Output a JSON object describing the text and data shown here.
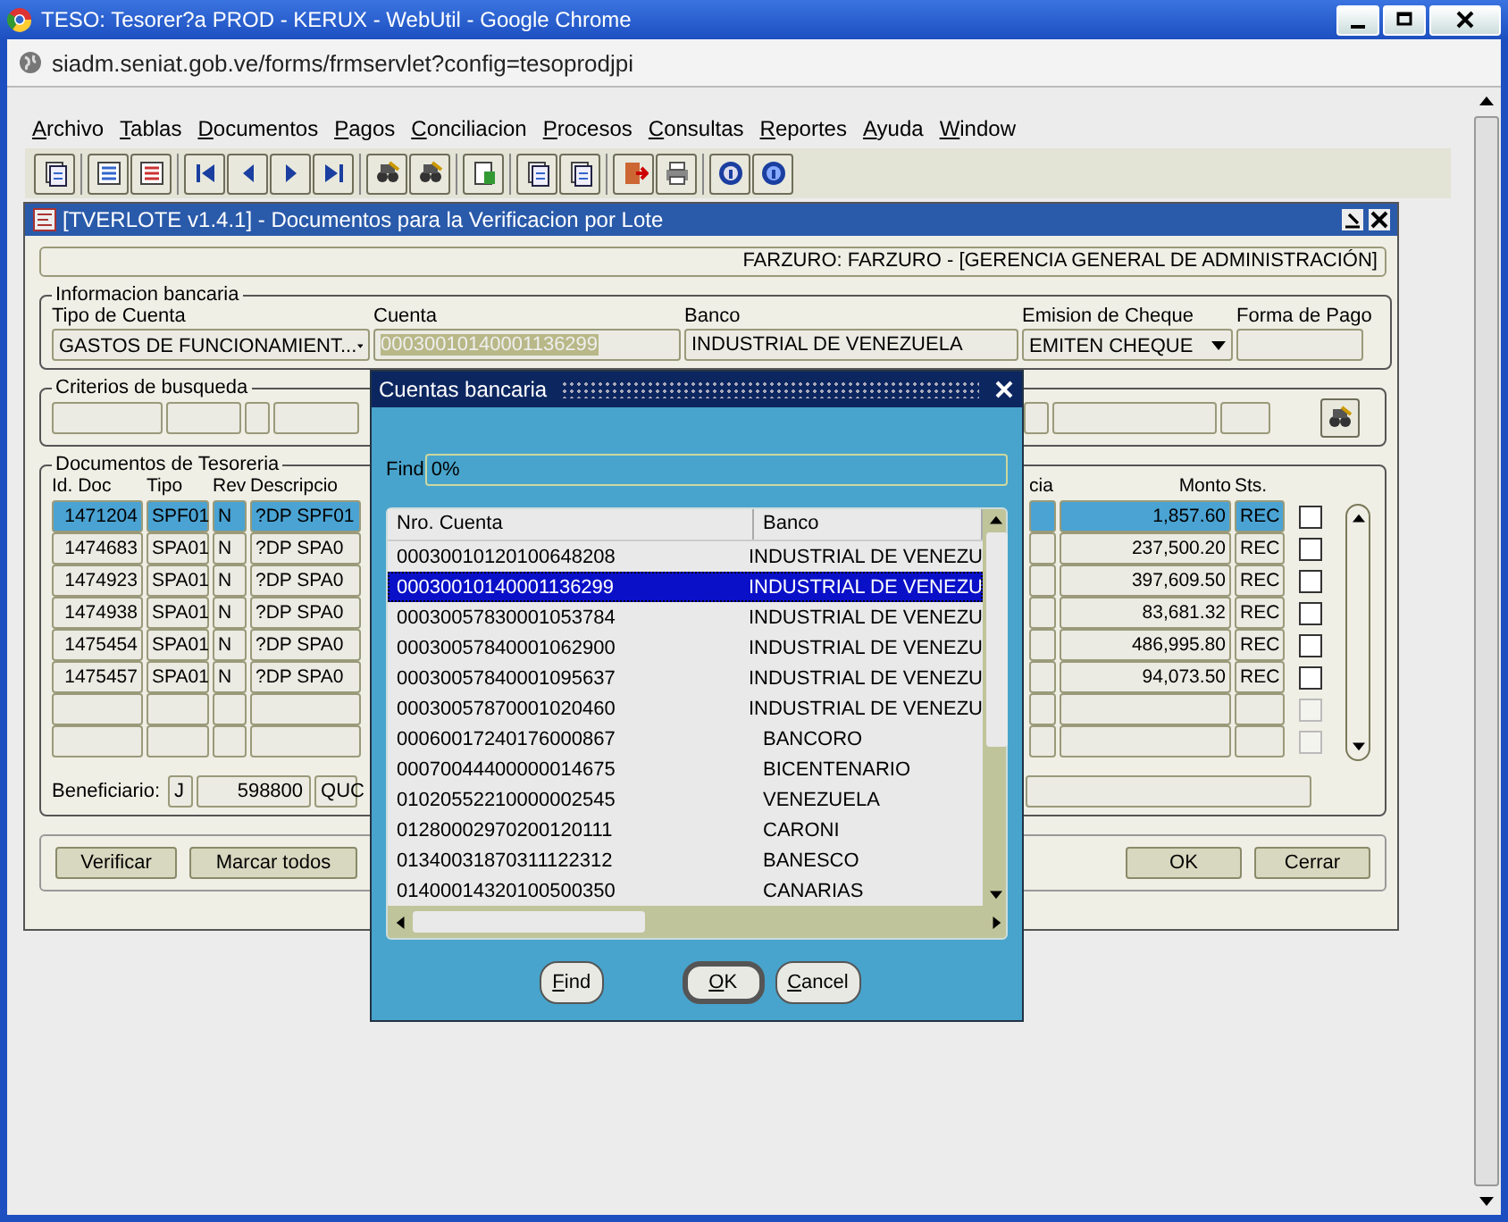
{
  "browser": {
    "title": "TESO: Tesorer?a PROD - KERUX - WebUtil - Google Chrome",
    "url": "siadm.seniat.gob.ve/forms/frmservlet?config=tesoprodjpi"
  },
  "menu": [
    "Archivo",
    "Tablas",
    "Documentos",
    "Pagos",
    "Conciliacion",
    "Procesos",
    "Consultas",
    "Reportes",
    "Ayuda",
    "Window"
  ],
  "window": {
    "title": "[TVERLOTE v1.4.1] - Documentos para la Verificacion por Lote",
    "user": "FARZURO: FARZURO -  [GERENCIA GENERAL DE ADMINISTRACIÓN]"
  },
  "bank_info": {
    "legend": "Informacion bancaria",
    "fields": [
      {
        "label": "Tipo de Cuenta",
        "value": "GASTOS DE FUNCIONAMIENT...",
        "kind": "combo"
      },
      {
        "label": "Cuenta",
        "value": "00030010140001136299",
        "kind": "highlighted"
      },
      {
        "label": "Banco",
        "value": "INDUSTRIAL DE VENEZUELA",
        "kind": "text"
      },
      {
        "label": "Emision de Cheque",
        "value": "EMITEN CHEQUE",
        "kind": "combo"
      },
      {
        "label": "Forma de Pago",
        "kind": "text"
      }
    ]
  },
  "search_criteria": {
    "legend": "Criterios de busqueda"
  },
  "documents": {
    "legend": "Documentos de Tesoreria",
    "columns": [
      "Id. Doc",
      "Tipo",
      "Rev",
      "Descripcio",
      "cia",
      "Monto",
      "Sts."
    ],
    "rows": [
      {
        "id_doc": "1471204",
        "tipo": "SPF01",
        "rev": "N",
        "descripcion": "?DP SPF01",
        "monto": "1,857.60",
        "sts": "REC",
        "selected": true,
        "checked": false
      },
      {
        "id_doc": "1474683",
        "tipo": "SPA01",
        "rev": "N",
        "descripcion": "?DP SPA0",
        "monto": "237,500.20",
        "sts": "REC",
        "selected": false,
        "checked": false
      },
      {
        "id_doc": "1474923",
        "tipo": "SPA01",
        "rev": "N",
        "descripcion": "?DP SPA0",
        "monto": "397,609.50",
        "sts": "REC",
        "selected": false,
        "checked": false
      },
      {
        "id_doc": "1474938",
        "tipo": "SPA01",
        "rev": "N",
        "descripcion": "?DP SPA0",
        "monto": "83,681.32",
        "sts": "REC",
        "selected": false,
        "checked": false
      },
      {
        "id_doc": "1475454",
        "tipo": "SPA01",
        "rev": "N",
        "descripcion": "?DP SPA0",
        "monto": "486,995.80",
        "sts": "REC",
        "selected": false,
        "checked": false
      },
      {
        "id_doc": "1475457",
        "tipo": "SPA01",
        "rev": "N",
        "descripcion": "?DP SPA0",
        "monto": "94,073.50",
        "sts": "REC",
        "selected": false,
        "checked": false
      }
    ],
    "empty_rows": [
      {
        "disabled": true
      },
      {
        "disabled": true
      }
    ]
  },
  "beneficiary": {
    "label": "Beneficiario:",
    "type": "J",
    "code": "598800",
    "name": "QUC"
  },
  "buttons_left": [
    "Verificar",
    "Marcar todos"
  ],
  "buttons_right": [
    "OK",
    "Cerrar"
  ],
  "dialog": {
    "title": "Cuentas bancaria",
    "find_label": "Find",
    "find_value": "0%",
    "columns": [
      "Nro. Cuenta",
      "Banco"
    ],
    "rows": [
      {
        "account": "00030010120100648208",
        "bank": "INDUSTRIAL DE VENEZU",
        "selected": false
      },
      {
        "account": "00030010140001136299",
        "bank": "INDUSTRIAL DE VENEZU",
        "selected": true
      },
      {
        "account": "00030057830001053784",
        "bank": "INDUSTRIAL DE VENEZU",
        "selected": false
      },
      {
        "account": "00030057840001062900",
        "bank": "INDUSTRIAL DE VENEZU",
        "selected": false
      },
      {
        "account": "00030057840001095637",
        "bank": "INDUSTRIAL DE VENEZU",
        "selected": false
      },
      {
        "account": "00030057870001020460",
        "bank": "INDUSTRIAL DE VENEZU",
        "selected": false
      },
      {
        "account": "00060017240176000867",
        "bank": "BANCORO",
        "selected": false
      },
      {
        "account": "00070044400000014675",
        "bank": "BICENTENARIO",
        "selected": false
      },
      {
        "account": "01020552210000002545",
        "bank": "VENEZUELA",
        "selected": false
      },
      {
        "account": "01280002970200120111",
        "bank": "CARONI",
        "selected": false
      },
      {
        "account": "01340031870311122312",
        "bank": "BANESCO",
        "selected": false
      },
      {
        "account": "01400014320100500350",
        "bank": "CANARIAS",
        "selected": false
      }
    ],
    "buttons": [
      {
        "label": "Find",
        "default": false
      },
      {
        "label": "OK",
        "default": true
      },
      {
        "label": "Cancel",
        "default": false
      }
    ]
  }
}
